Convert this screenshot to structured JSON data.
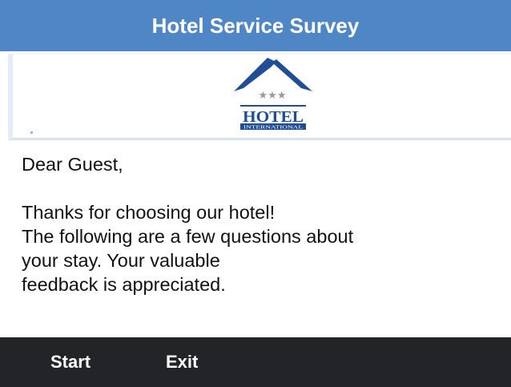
{
  "header": {
    "title": "Hotel Service Survey"
  },
  "logo": {
    "icon": "hotel-logo",
    "stars": "★★★",
    "text": "HOTEL",
    "subtext": "INTERNATIONAL",
    "colors": {
      "mountain": "#1f4e96",
      "star": "#9a9a9a",
      "plate": "#1f4e96"
    }
  },
  "message": {
    "greeting": "Dear Guest,",
    "lines": [
      "Thanks for choosing our hotel!",
      "The following are a few questions about",
      "your stay. Your valuable",
      "feedback is appreciated."
    ]
  },
  "softkeys": {
    "start_label": "Start",
    "exit_label": "Exit"
  },
  "colors": {
    "title_bar": "#4f86c6",
    "softkey_bar": "#222427",
    "text": "#111111"
  }
}
